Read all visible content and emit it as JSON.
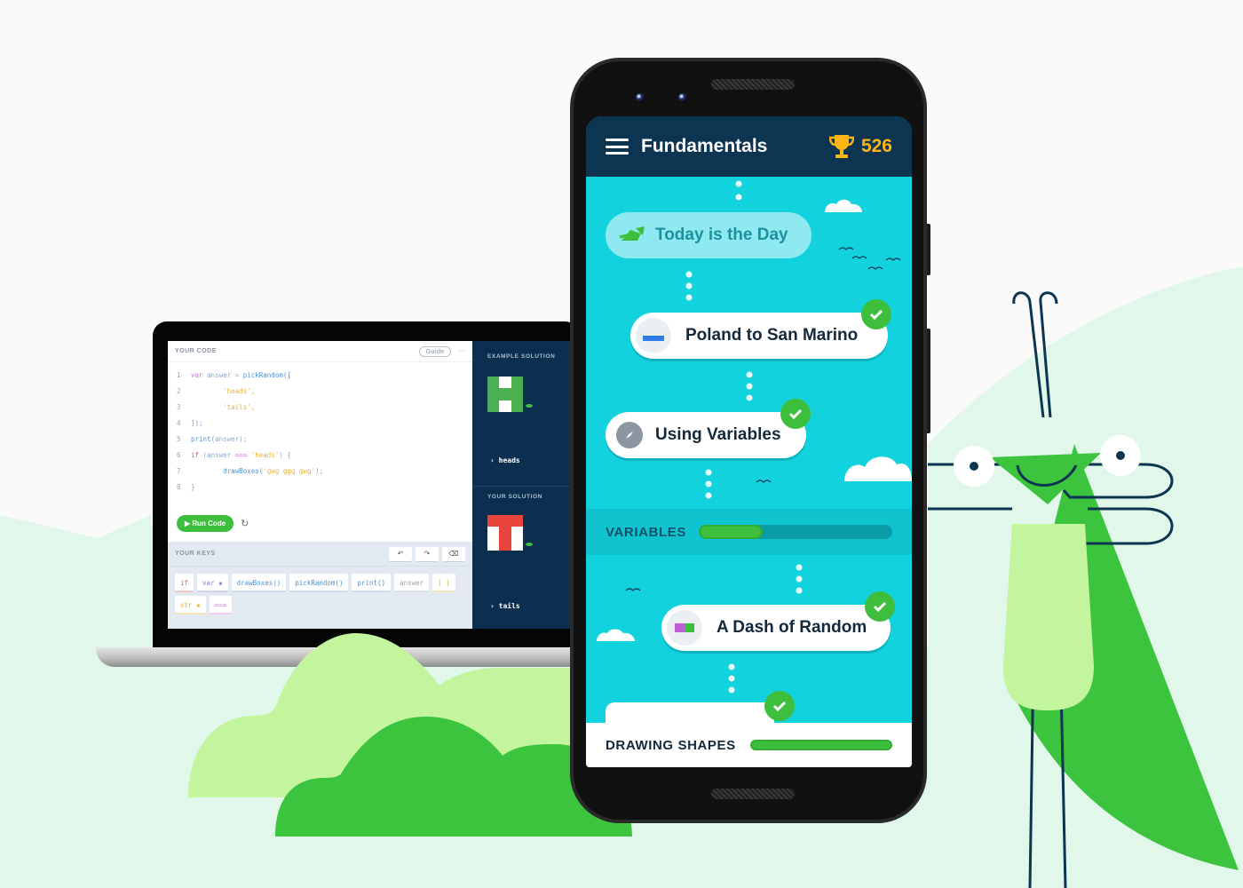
{
  "laptop": {
    "editor": {
      "header_label": "YOUR CODE",
      "guide_button": "Guide",
      "more_button": "···",
      "lines": [
        {
          "n": "1",
          "segments": [
            {
              "t": "var ",
              "c": "#b77ad6"
            },
            {
              "t": "answer",
              "c": "#8fa5cf"
            },
            {
              "t": " = ",
              "c": "#8fa5cf"
            },
            {
              "t": "pickRandom([",
              "c": "#4a90d9"
            }
          ]
        },
        {
          "n": "2",
          "segments": [
            {
              "t": "        'heads',",
              "c": "#e3b341"
            }
          ]
        },
        {
          "n": "3",
          "segments": [
            {
              "t": "        'tails',",
              "c": "#e3b341"
            }
          ]
        },
        {
          "n": "4",
          "segments": [
            {
              "t": "]);",
              "c": "#b77ad6"
            }
          ]
        },
        {
          "n": "5",
          "segments": [
            {
              "t": "print",
              "c": "#4a90d9"
            },
            {
              "t": "(answer);",
              "c": "#8fa5cf"
            }
          ]
        },
        {
          "n": "6",
          "segments": [
            {
              "t": "if",
              "c": "#e0555b"
            },
            {
              "t": " (answer ",
              "c": "#8fa5cf"
            },
            {
              "t": "===",
              "c": "#d46ad6"
            },
            {
              "t": " 'heads'",
              "c": "#e3b341"
            },
            {
              "t": ") {",
              "c": "#8fa5cf"
            }
          ]
        },
        {
          "n": "7",
          "segments": [
            {
              "t": "        drawBoxes(",
              "c": "#4a90d9"
            },
            {
              "t": "'gwg ggg gwg'",
              "c": "#e3b341"
            },
            {
              "t": ");",
              "c": "#8fa5cf"
            }
          ]
        },
        {
          "n": "8",
          "segments": [
            {
              "t": "}",
              "c": "#b77ad6"
            }
          ]
        }
      ],
      "run_button": "▶ Run Code",
      "refresh_icon": "↻"
    },
    "keys": {
      "header_label": "YOUR KEYS",
      "undo_icon": "↶",
      "redo_icon": "↷",
      "backspace_icon": "⌫",
      "items": [
        {
          "label": "if",
          "color": "#e0555b",
          "border": "#f3c7c9"
        },
        {
          "label": "var ▪",
          "color": "#8a7fd6",
          "border": "#d3d0f0"
        },
        {
          "label": "drawBoxes()",
          "color": "#4a90d9",
          "border": "#c9dcf2"
        },
        {
          "label": "pickRandom()",
          "color": "#4a90d9",
          "border": "#c9dcf2"
        },
        {
          "label": "print()",
          "color": "#4a90d9",
          "border": "#c9dcf2"
        },
        {
          "label": "answer",
          "color": "#9aa3ad",
          "border": "#dde2e8"
        },
        {
          "label": "[ ]",
          "color": "#e3b341",
          "border": "#f3e3b8"
        },
        {
          "label": "str ▪",
          "color": "#e3b341",
          "border": "#f3e3b8"
        },
        {
          "label": "===",
          "color": "#d46ad6",
          "border": "#efcdf0"
        }
      ]
    },
    "solution": {
      "example_label": "EXAMPLE SOLUTION",
      "example_output": "› heads",
      "your_label": "YOUR SOLUTION",
      "your_output": "› tails"
    }
  },
  "phone": {
    "app_bar": {
      "menu_icon": "hamburger-menu",
      "title": "Fundamentals",
      "trophy_icon": "trophy",
      "score": "526"
    },
    "lessons": [
      {
        "title": "Today is the Day",
        "completed": false,
        "icon": "grasshopper"
      },
      {
        "title": "Poland to San Marino",
        "completed": true,
        "icon": "flag"
      },
      {
        "title": "Using Variables",
        "completed": true,
        "icon": "compass"
      },
      {
        "title": "A Dash of Random",
        "completed": true,
        "icon": "color-squares"
      },
      {
        "title": "",
        "completed": true,
        "icon": ""
      }
    ],
    "sections": [
      {
        "label": "VARIABLES",
        "progress": 0.33
      },
      {
        "label": "DRAWING SHAPES",
        "progress": 1.0
      }
    ]
  },
  "colors": {
    "brand_green": "#3dbf3d",
    "light_green": "#c3f59e",
    "navy": "#0d3450",
    "cyan": "#12d3dd",
    "gold": "#fdb515"
  }
}
